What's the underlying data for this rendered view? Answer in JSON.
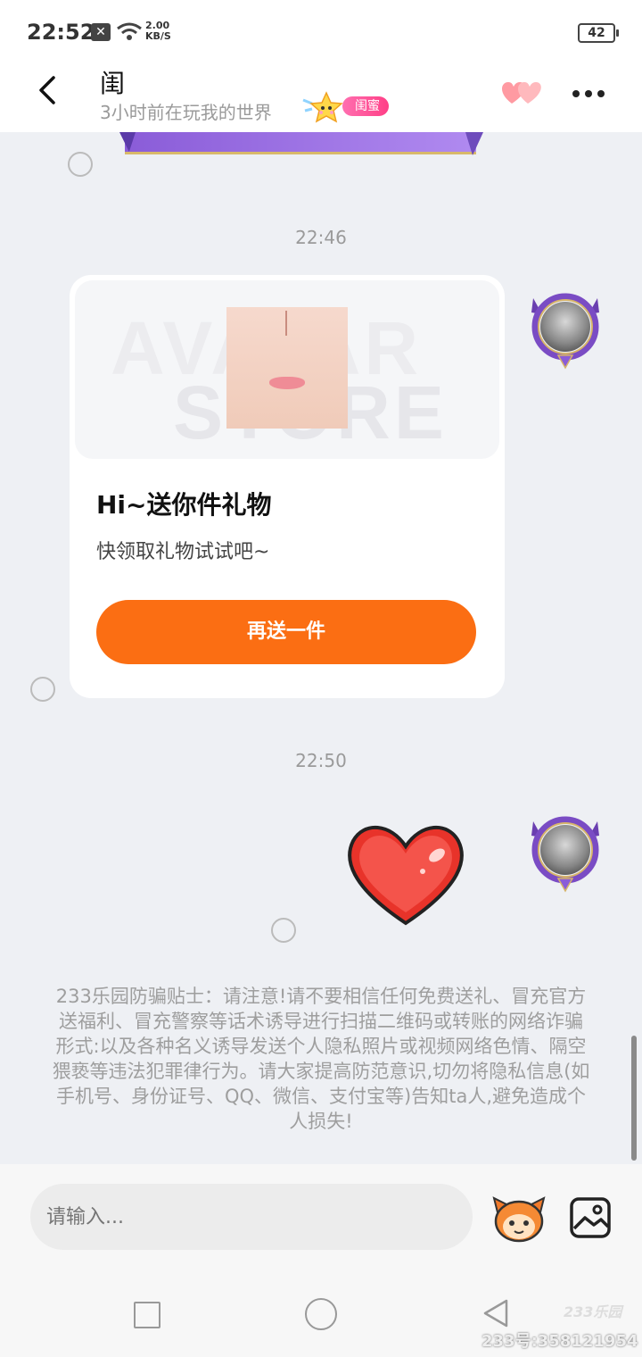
{
  "status_bar": {
    "time": "22:52",
    "notif_icon": "x-box-icon",
    "speed": "2.00",
    "speed_unit": "KB/S",
    "battery": "42"
  },
  "header": {
    "title": "闺",
    "subtitle": "3小时前在玩我的世界",
    "tag": "闺蜜"
  },
  "messages": {
    "time_1": "22:46",
    "gift": {
      "title": "Hi~送你件礼物",
      "subtitle": "快领取礼物试试吧~",
      "button": "再送一件",
      "watermark_top": "AVATAR",
      "watermark_bottom": "STORE"
    },
    "time_2": "22:50"
  },
  "safety_tip": "233乐园防骗贴士：请注意!请不要相信任何免费送礼、冒充官方送福利、冒充警察等话术诱导进行扫描二维码或转账的网络诈骗形式:以及各种名义诱导发送个人隐私照片或视频网络色情、隔空猥亵等违法犯罪律行为。请大家提高防范意识,切勿将隐私信息(如手机号、身份证号、QQ、微信、支付宝等)告知ta人,避免造成个人损失!",
  "input": {
    "placeholder": "请输入..."
  },
  "watermark": {
    "logo": "233乐园",
    "id": "233号:358121954"
  },
  "colors": {
    "accent": "#fb6e13",
    "tag": "#ff4f91"
  }
}
